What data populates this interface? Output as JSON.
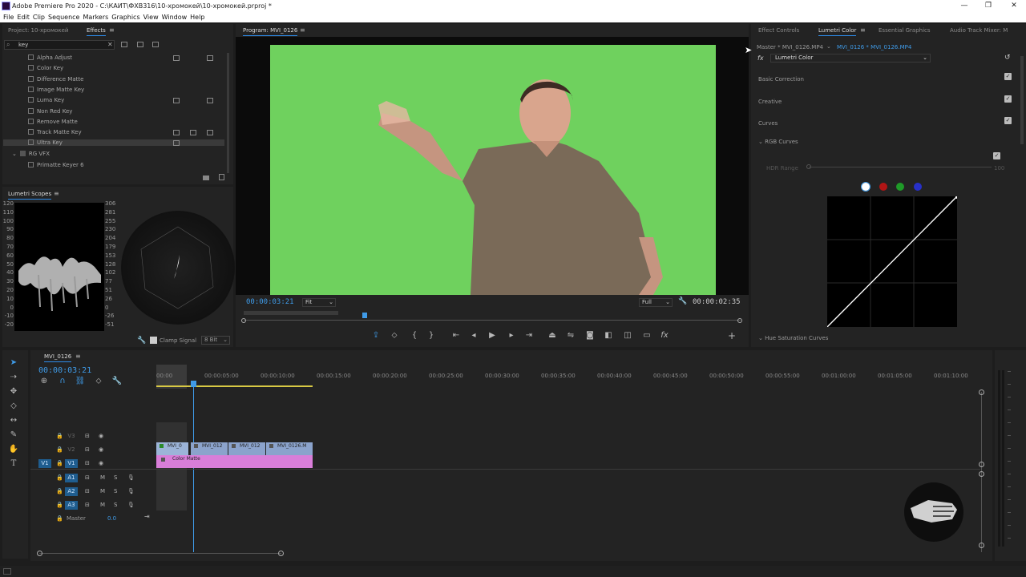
{
  "window": {
    "title": "Adobe Premiere Pro 2020 - C:\\КАИТ\\ФХВ316\\10-хромокей\\10-хромокей.prproj *",
    "controls": [
      "—",
      "❐",
      "✕"
    ]
  },
  "menu": [
    "File",
    "Edit",
    "Clip",
    "Sequence",
    "Markers",
    "Graphics",
    "View",
    "Window",
    "Help"
  ],
  "project_panel": {
    "tabs": [
      "Project: 10-хромокей",
      "Effects"
    ],
    "active_tab": "Effects",
    "search_value": "key",
    "effects": [
      {
        "name": "Alpha Adjust",
        "badges": 2
      },
      {
        "name": "Color Key",
        "badges": 0
      },
      {
        "name": "Difference Matte",
        "badges": 0
      },
      {
        "name": "Image Matte Key",
        "badges": 0
      },
      {
        "name": "Luma Key",
        "badges": 2
      },
      {
        "name": "Non Red Key",
        "badges": 0
      },
      {
        "name": "Remove Matte",
        "badges": 0
      },
      {
        "name": "Track Matte Key",
        "badges": 3
      },
      {
        "name": "Ultra Key",
        "badges": 1
      }
    ],
    "folder": "RG VFX",
    "folder_item": "Primatte Keyer 6"
  },
  "scopes": {
    "title": "Lumetri Scopes",
    "left_scale": [
      "120",
      "110",
      "100",
      "90",
      "80",
      "70",
      "60",
      "50",
      "40",
      "30",
      "20",
      "10",
      "0",
      "-10",
      "-20"
    ],
    "right_scale": [
      "306",
      "281",
      "255",
      "230",
      "204",
      "179",
      "153",
      "128",
      "102",
      "77",
      "51",
      "26",
      "0",
      "-26",
      "-51"
    ],
    "clamp_label": "Clamp Signal",
    "bit_depth": "8 Bit"
  },
  "program": {
    "title": "Program: MVI_0126",
    "timecode": "00:00:03:21",
    "fit": "Fit",
    "quality": "Full",
    "duration": "00:00:02:35"
  },
  "right_panel": {
    "tabs": [
      "Effect Controls",
      "Lumetri Color",
      "Essential Graphics",
      "Audio Track Mixer: M"
    ],
    "active_tab": "Lumetri Color",
    "master": "Master * MVI_0126.MP4",
    "clip": "MVI_0126 * MVI_0126.MP4",
    "effect": "Lumetri Color",
    "sections": [
      "Basic Correction",
      "Creative",
      "Curves"
    ],
    "rgb_curves": "RGB Curves",
    "hdr_range": "HDR Range",
    "hdr_value": "100",
    "hue_sat": "Hue Saturation Curves",
    "channel_colors": [
      "#ffffff",
      "#b01515",
      "#1f9a28",
      "#2730c9"
    ]
  },
  "timeline": {
    "title": "MVI_0126",
    "timecode": "00:00:03:21",
    "ruler": [
      "00:00",
      "00:00:05:00",
      "00:00:10:00",
      "00:00:15:00",
      "00:00:20:00",
      "00:00:25:00",
      "00:00:30:00",
      "00:00:35:00",
      "00:00:40:00",
      "00:00:45:00",
      "00:00:50:00",
      "00:00:55:00",
      "00:01:00:00",
      "00:01:05:00",
      "00:01:10:00"
    ],
    "video_tracks": [
      "V3",
      "V2",
      "V1"
    ],
    "audio_tracks": [
      "A1",
      "A2",
      "A3"
    ],
    "source_v1": "V1",
    "source_a1": "A1",
    "master_label": "Master",
    "master_value": "0.0",
    "clips_v2": [
      "MVI_0",
      "MVI_012",
      "MVI_012",
      "MVI_0126.M"
    ],
    "clip_v1": "Color Matte",
    "track_buttons": {
      "mute": "M",
      "solo": "S"
    }
  }
}
